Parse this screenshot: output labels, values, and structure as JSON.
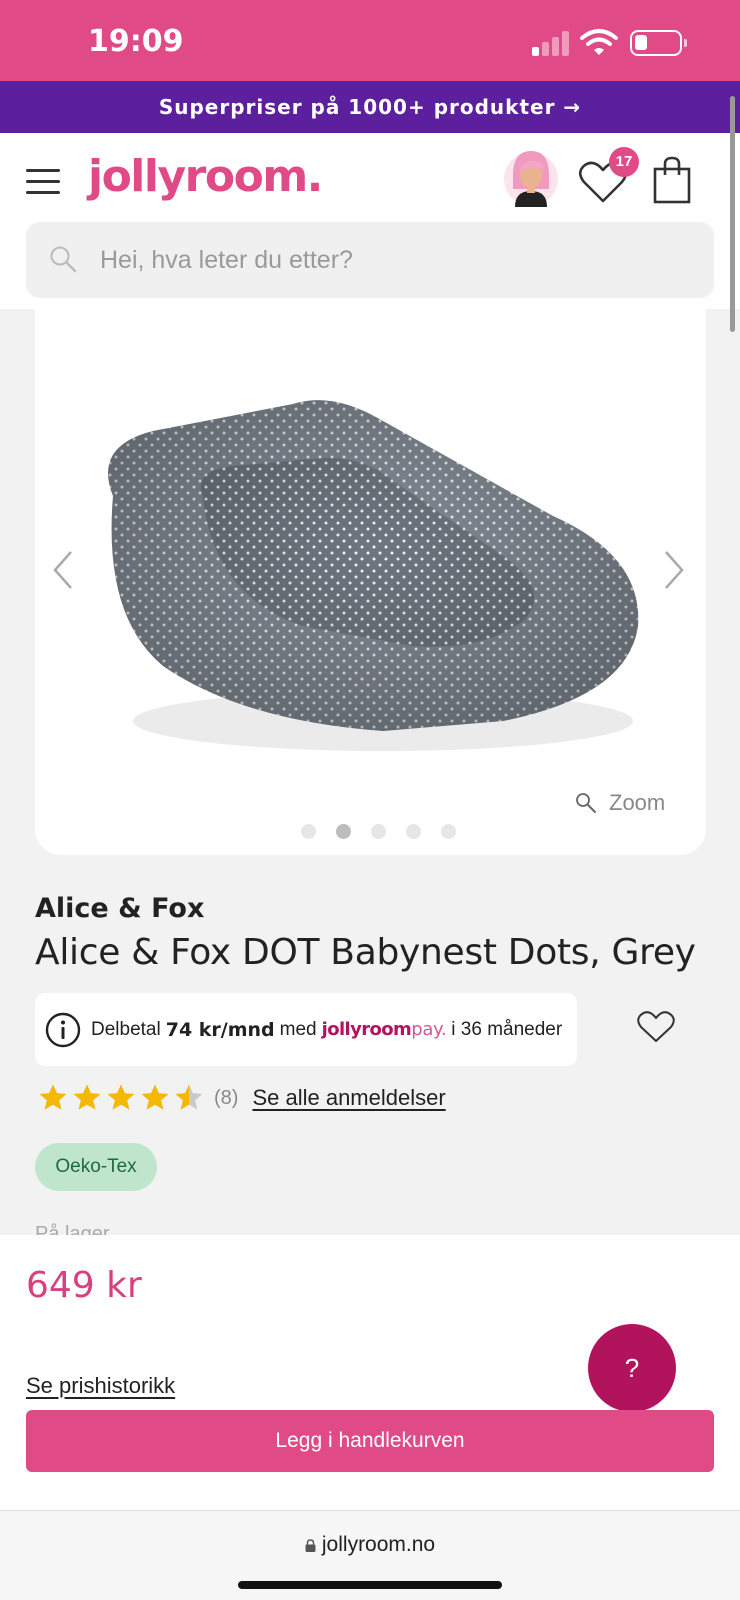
{
  "status_bar": {
    "time": "19:09"
  },
  "promo": {
    "text": "Superpriser på 1000+ produkter →"
  },
  "header": {
    "logo": "jollyroom.",
    "wishlist_count": "17",
    "search_placeholder": "Hei, hva leter du etter?"
  },
  "gallery": {
    "zoom_label": "Zoom",
    "image_count": 5,
    "active_index": 1
  },
  "product": {
    "brand": "Alice & Fox",
    "title": "Alice & Fox DOT Babynest Dots, Grey",
    "payment": {
      "prefix": "Delbetal",
      "amount": "74 kr/mnd",
      "with": "med",
      "brand_main": "jollyroom",
      "brand_suffix": "pay.",
      "term": "i 36 måneder"
    },
    "rating": {
      "value": 4.5,
      "max": 5,
      "count_label": "(8)",
      "link": "Se alle anmeldelser"
    },
    "badge": "Oeko-Tex",
    "stock_label": "På lager"
  },
  "purchase": {
    "price": "649 kr",
    "history_link": "Se prishistorikk",
    "help_label": "?",
    "cart_button": "Legg i handlekurven"
  },
  "browser": {
    "url": "jollyroom.no"
  },
  "colors": {
    "brand_pink": "#e04a86",
    "promo_purple": "#5c1f9e",
    "help_magenta": "#b2135d",
    "badge_green": "#bfe5cc",
    "star_gold": "#f5b800"
  }
}
